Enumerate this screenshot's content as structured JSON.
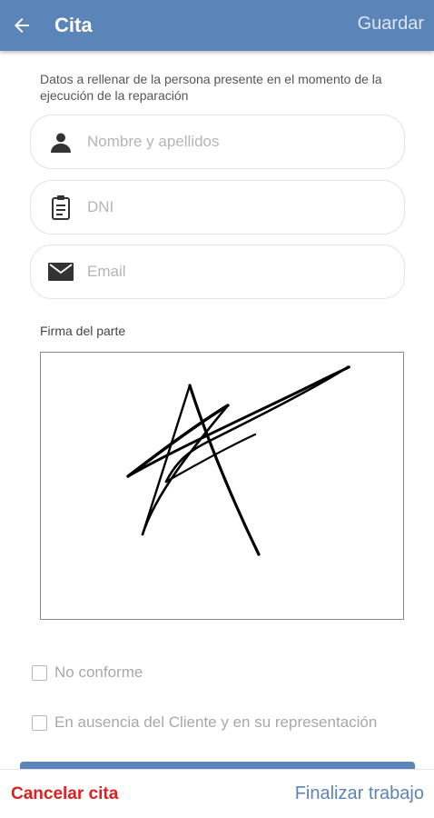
{
  "header": {
    "title": "Cita",
    "save_label": "Guardar",
    "back_icon": "arrow-left-icon",
    "bar_color": "#5b84b8"
  },
  "form": {
    "intro_text": "Datos a rellenar de la persona presente en el momento de la ejecución de la reparación",
    "name": {
      "placeholder": "Nombre y apellidos",
      "value": "",
      "icon": "person-icon"
    },
    "dni": {
      "placeholder": "DNI",
      "value": "",
      "icon": "id-document-icon"
    },
    "email": {
      "placeholder": "Email",
      "value": "",
      "icon": "envelope-icon"
    },
    "signature_label": "Firma del parte"
  },
  "checkboxes": [
    {
      "label": "No conforme",
      "checked": false
    },
    {
      "label": "En ausencia del Cliente y en su representación",
      "checked": false
    }
  ],
  "footer": {
    "cancel_label": "Cancelar cita",
    "finish_label": "Finalizar trabajo",
    "cancel_color": "#e02020",
    "finish_color": "#5b84b8"
  }
}
